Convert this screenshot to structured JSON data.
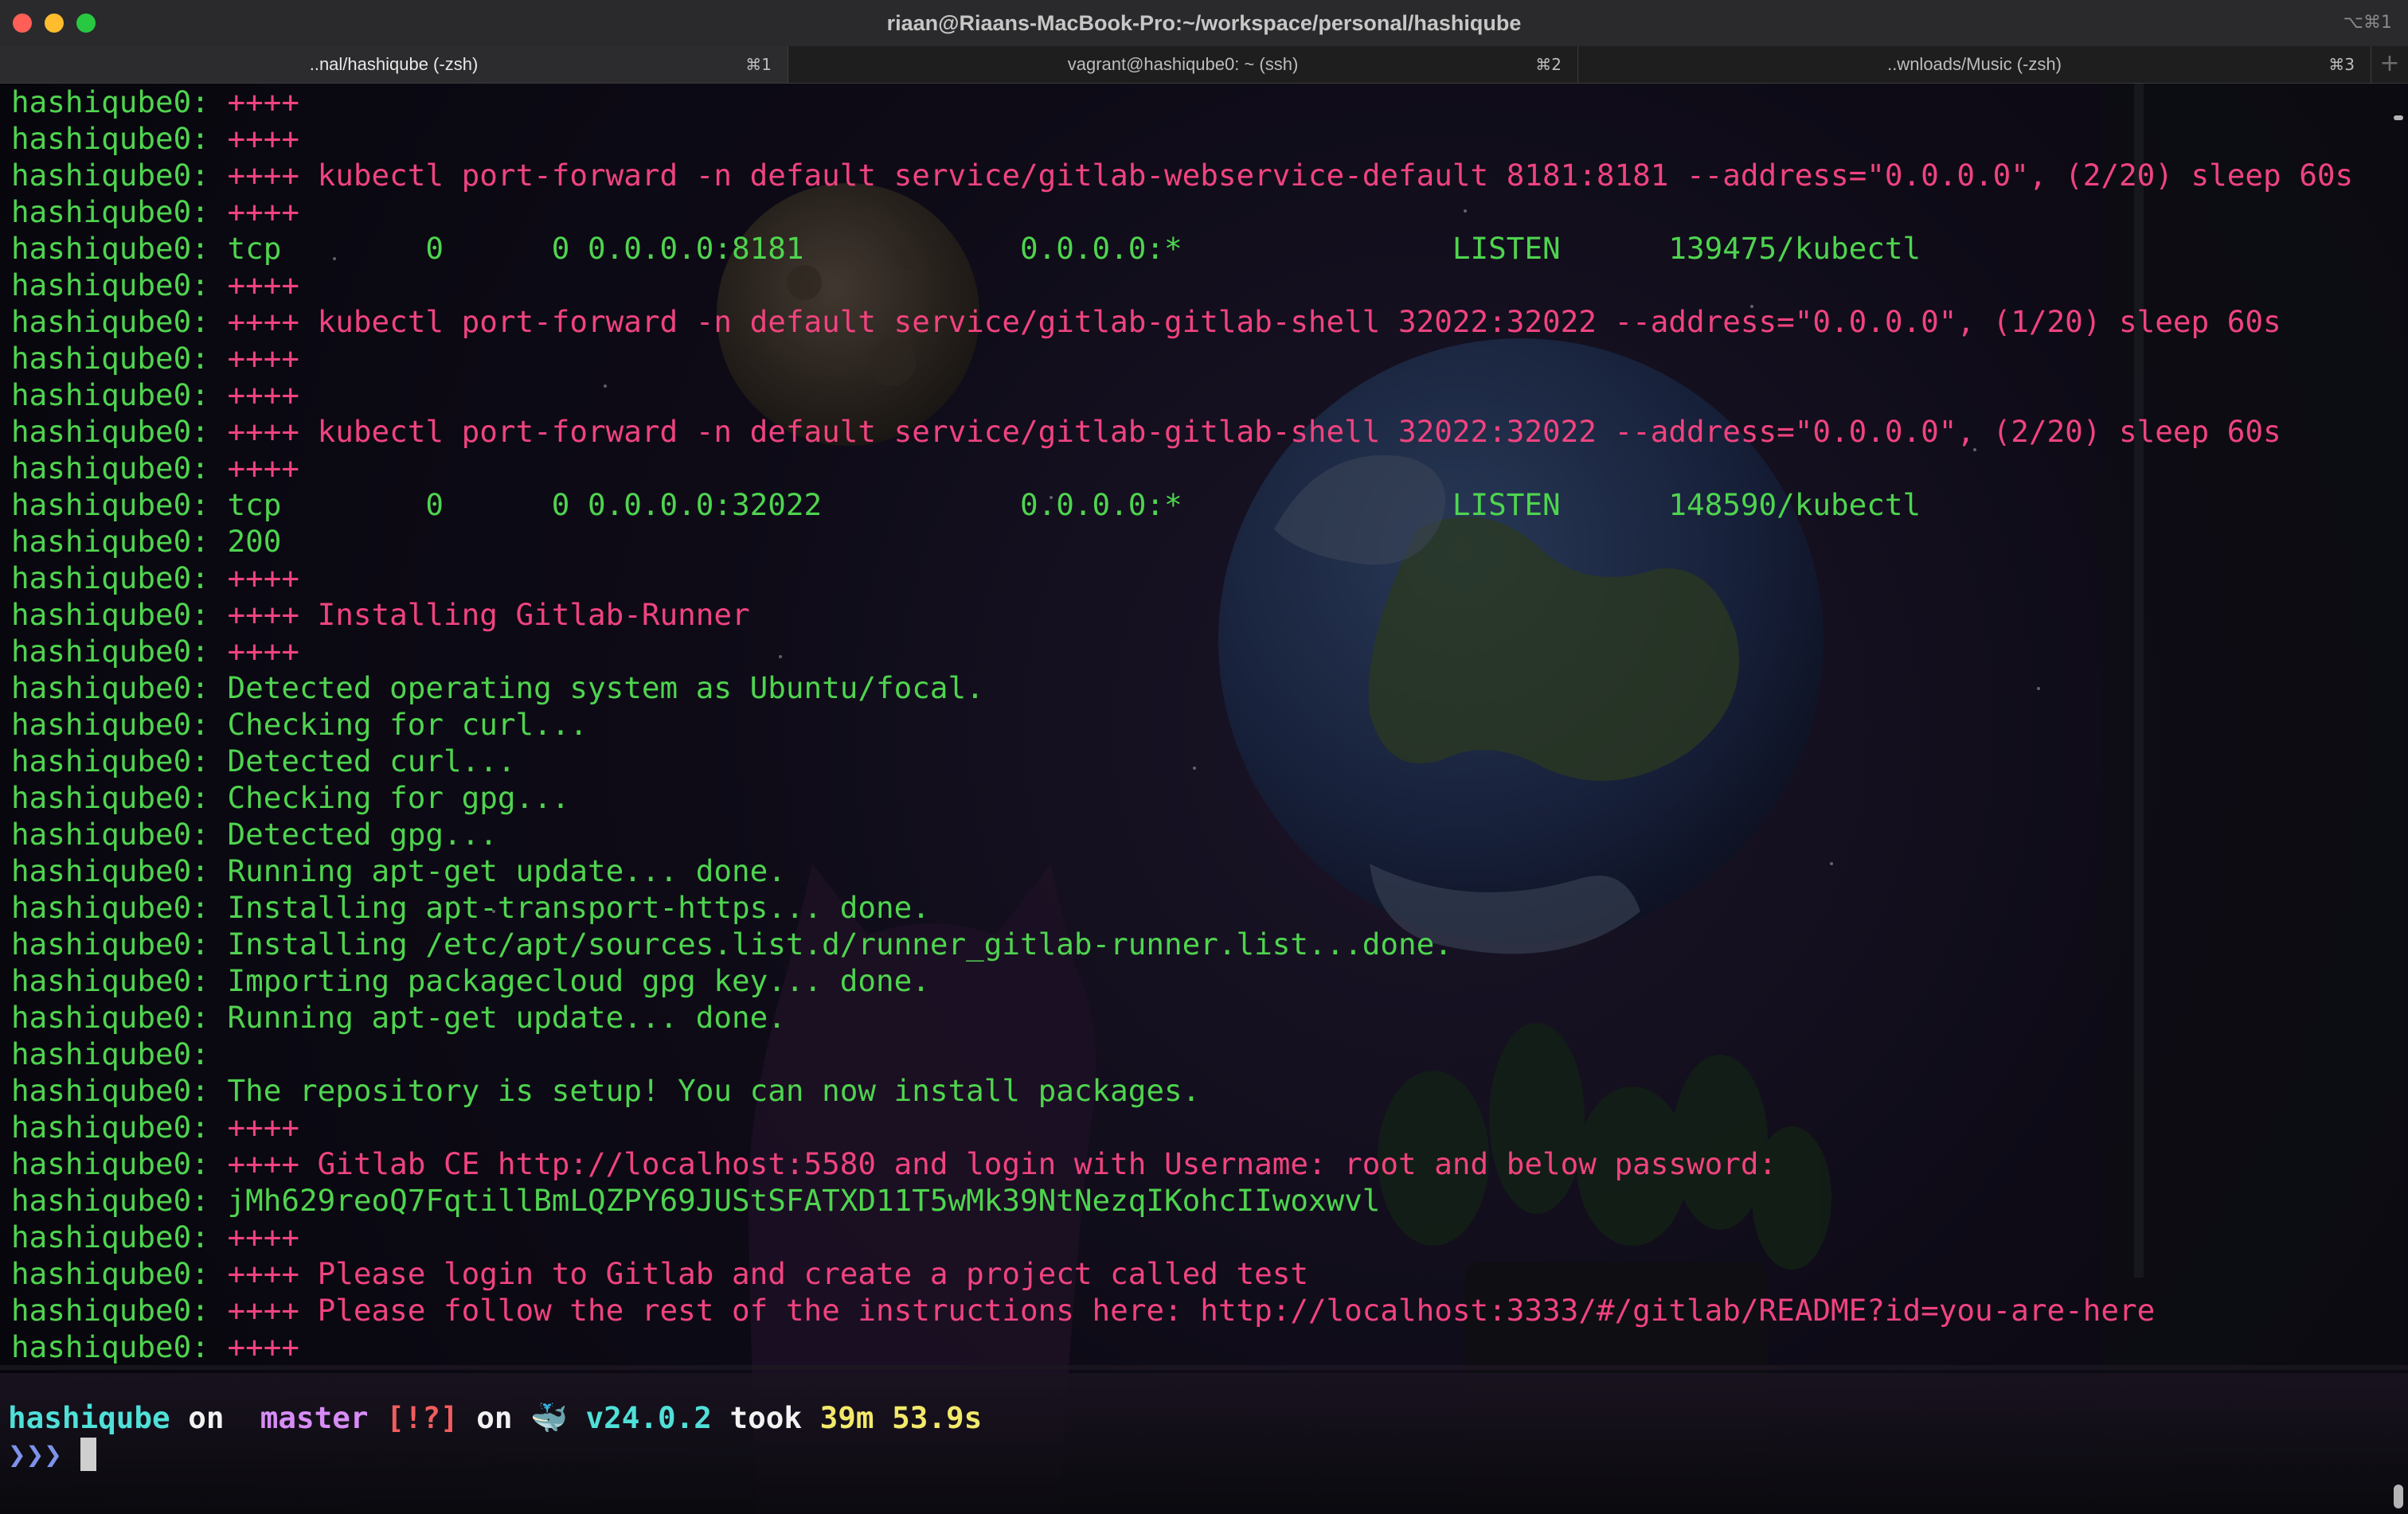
{
  "window": {
    "title": "riaan@Riaans-MacBook-Pro:~/workspace/personal/hashiqube",
    "title_shortcut": "⌥⌘1"
  },
  "tabs": [
    {
      "label": "..nal/hashiqube (-zsh)",
      "shortcut": "⌘1",
      "active": true
    },
    {
      "label": "vagrant@hashiqube0: ~ (ssh)",
      "shortcut": "⌘2",
      "active": false
    },
    {
      "label": "..wnloads/Music (-zsh)",
      "shortcut": "⌘3",
      "active": false
    }
  ],
  "tab_add_label": "+",
  "colors": {
    "green": "#4fd44f",
    "pink": "#f0437f",
    "cyan": "#4fe0d8",
    "magenta": "#d78cf5",
    "yellow": "#f2e96a"
  },
  "terminal": {
    "lines": [
      {
        "prefix": "hashiqube0: ",
        "text": "++++",
        "color": "red"
      },
      {
        "prefix": "hashiqube0: ",
        "text": "++++",
        "color": "red"
      },
      {
        "prefix": "hashiqube0: ",
        "text": "++++ kubectl port-forward -n default service/gitlab-webservice-default 8181:8181 --address=\"0.0.0.0\", (2/20) sleep 60s",
        "color": "red"
      },
      {
        "prefix": "hashiqube0: ",
        "text": "++++",
        "color": "red"
      },
      {
        "prefix": "hashiqube0: ",
        "text": "tcp        0      0 0.0.0.0:8181            0.0.0.0:*               LISTEN      139475/kubectl",
        "color": "green"
      },
      {
        "prefix": "hashiqube0: ",
        "text": "++++",
        "color": "red"
      },
      {
        "prefix": "hashiqube0: ",
        "text": "++++ kubectl port-forward -n default service/gitlab-gitlab-shell 32022:32022 --address=\"0.0.0.0\", (1/20) sleep 60s",
        "color": "red"
      },
      {
        "prefix": "hashiqube0: ",
        "text": "++++",
        "color": "red"
      },
      {
        "prefix": "hashiqube0: ",
        "text": "++++",
        "color": "red"
      },
      {
        "prefix": "hashiqube0: ",
        "text": "++++ kubectl port-forward -n default service/gitlab-gitlab-shell 32022:32022 --address=\"0.0.0.0\", (2/20) sleep 60s",
        "color": "red"
      },
      {
        "prefix": "hashiqube0: ",
        "text": "++++",
        "color": "red"
      },
      {
        "prefix": "hashiqube0: ",
        "text": "tcp        0      0 0.0.0.0:32022           0.0.0.0:*               LISTEN      148590/kubectl",
        "color": "green"
      },
      {
        "prefix": "hashiqube0: ",
        "text": "200",
        "color": "green"
      },
      {
        "prefix": "hashiqube0: ",
        "text": "++++",
        "color": "red"
      },
      {
        "prefix": "hashiqube0: ",
        "text": "++++ Installing Gitlab-Runner",
        "color": "red"
      },
      {
        "prefix": "hashiqube0: ",
        "text": "++++",
        "color": "red"
      },
      {
        "prefix": "hashiqube0: ",
        "text": "Detected operating system as Ubuntu/focal.",
        "color": "green"
      },
      {
        "prefix": "hashiqube0: ",
        "text": "Checking for curl...",
        "color": "green"
      },
      {
        "prefix": "hashiqube0: ",
        "text": "Detected curl...",
        "color": "green"
      },
      {
        "prefix": "hashiqube0: ",
        "text": "Checking for gpg...",
        "color": "green"
      },
      {
        "prefix": "hashiqube0: ",
        "text": "Detected gpg...",
        "color": "green"
      },
      {
        "prefix": "hashiqube0: ",
        "text": "Running apt-get update... done.",
        "color": "green"
      },
      {
        "prefix": "hashiqube0: ",
        "text": "Installing apt-transport-https... done.",
        "color": "green"
      },
      {
        "prefix": "hashiqube0: ",
        "text": "Installing /etc/apt/sources.list.d/runner_gitlab-runner.list...done.",
        "color": "green"
      },
      {
        "prefix": "hashiqube0: ",
        "text": "Importing packagecloud gpg key... done.",
        "color": "green"
      },
      {
        "prefix": "hashiqube0: ",
        "text": "Running apt-get update... done.",
        "color": "green"
      },
      {
        "prefix": "hashiqube0:",
        "text": "",
        "color": "green"
      },
      {
        "prefix": "hashiqube0: ",
        "text": "The repository is setup! You can now install packages.",
        "color": "green"
      },
      {
        "prefix": "hashiqube0: ",
        "text": "++++",
        "color": "red"
      },
      {
        "prefix": "hashiqube0: ",
        "text": "++++ Gitlab CE http://localhost:5580 and login with Username: root and below password:",
        "color": "red"
      },
      {
        "prefix": "hashiqube0: ",
        "text": "jMh629reoQ7FqtillBmLQZPY69JUStSFATXD11T5wMk39NtNezqIKohcIIwoxwvl",
        "color": "green"
      },
      {
        "prefix": "hashiqube0: ",
        "text": "++++",
        "color": "red"
      },
      {
        "prefix": "hashiqube0: ",
        "text": "++++ Please login to Gitlab and create a project called test",
        "color": "red"
      },
      {
        "prefix": "hashiqube0: ",
        "text": "++++ Please follow the rest of the instructions here: http://localhost:3333/#/gitlab/README?id=you-are-here",
        "color": "red"
      },
      {
        "prefix": "hashiqube0: ",
        "text": "++++",
        "color": "red"
      }
    ],
    "prompt": {
      "dir": "hashiqube",
      "on1": " on ",
      "branch_icon": "",
      "branch": "master",
      "status": "[!?]",
      "on2": " on ",
      "docker_icon": "🐳",
      "version": "v24.0.2",
      "took": " took ",
      "duration": "39m 53.9s"
    },
    "input_prompt": "❯❯❯ "
  }
}
